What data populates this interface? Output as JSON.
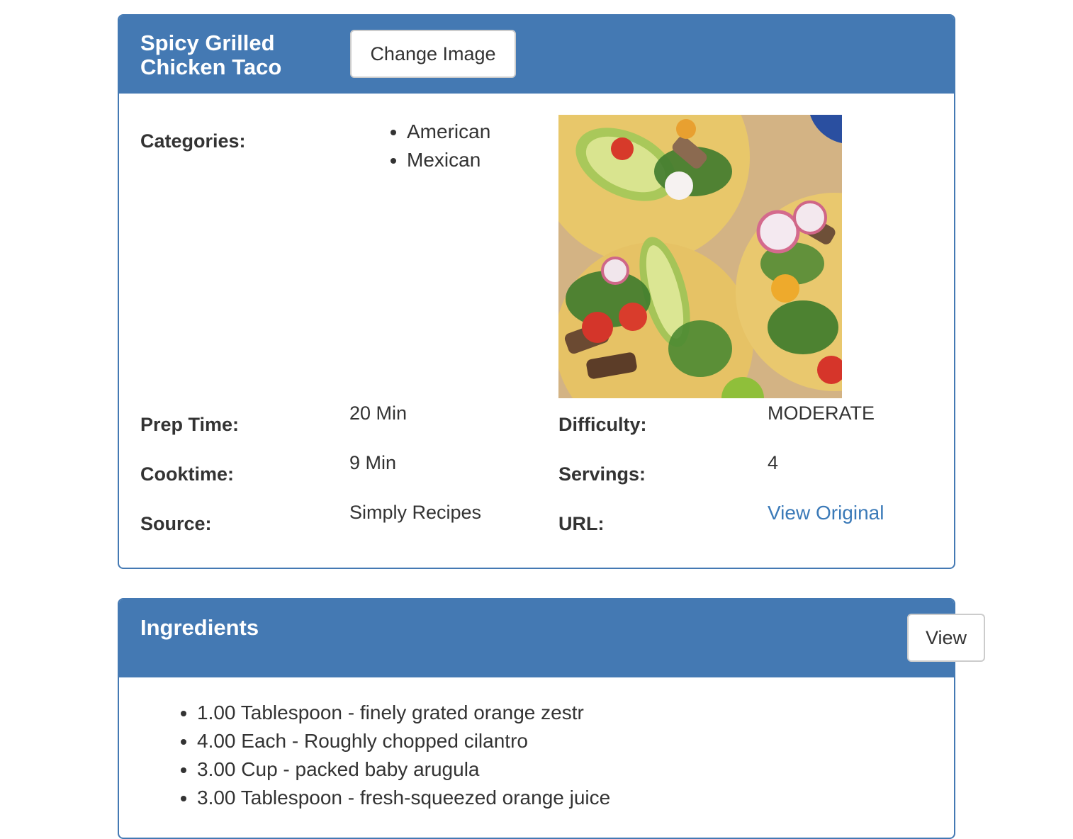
{
  "recipe": {
    "title": "Spicy Grilled Chicken Taco",
    "change_image_label": "Change Image",
    "categories_label": "Categories:",
    "categories": [
      "American",
      "Mexican"
    ],
    "prep_time_label": "Prep Time:",
    "prep_time": "20 Min",
    "cooktime_label": "Cooktime:",
    "cooktime": "9 Min",
    "source_label": "Source:",
    "source": "Simply Recipes",
    "difficulty_label": "Difficulty:",
    "difficulty": "MODERATE",
    "servings_label": "Servings:",
    "servings": "4",
    "url_label": "URL:",
    "url_link_text": "View Original"
  },
  "ingredients": {
    "title": "Ingredients",
    "view_label": "View",
    "items": [
      "1.00 Tablespoon - finely grated orange zestr",
      "4.00 Each - Roughly chopped cilantro",
      "3.00 Cup - packed baby arugula",
      "3.00 Tablespoon - fresh-squeezed orange juice"
    ]
  },
  "colors": {
    "header_bg": "#4479b3",
    "link": "#3b7ab8"
  }
}
